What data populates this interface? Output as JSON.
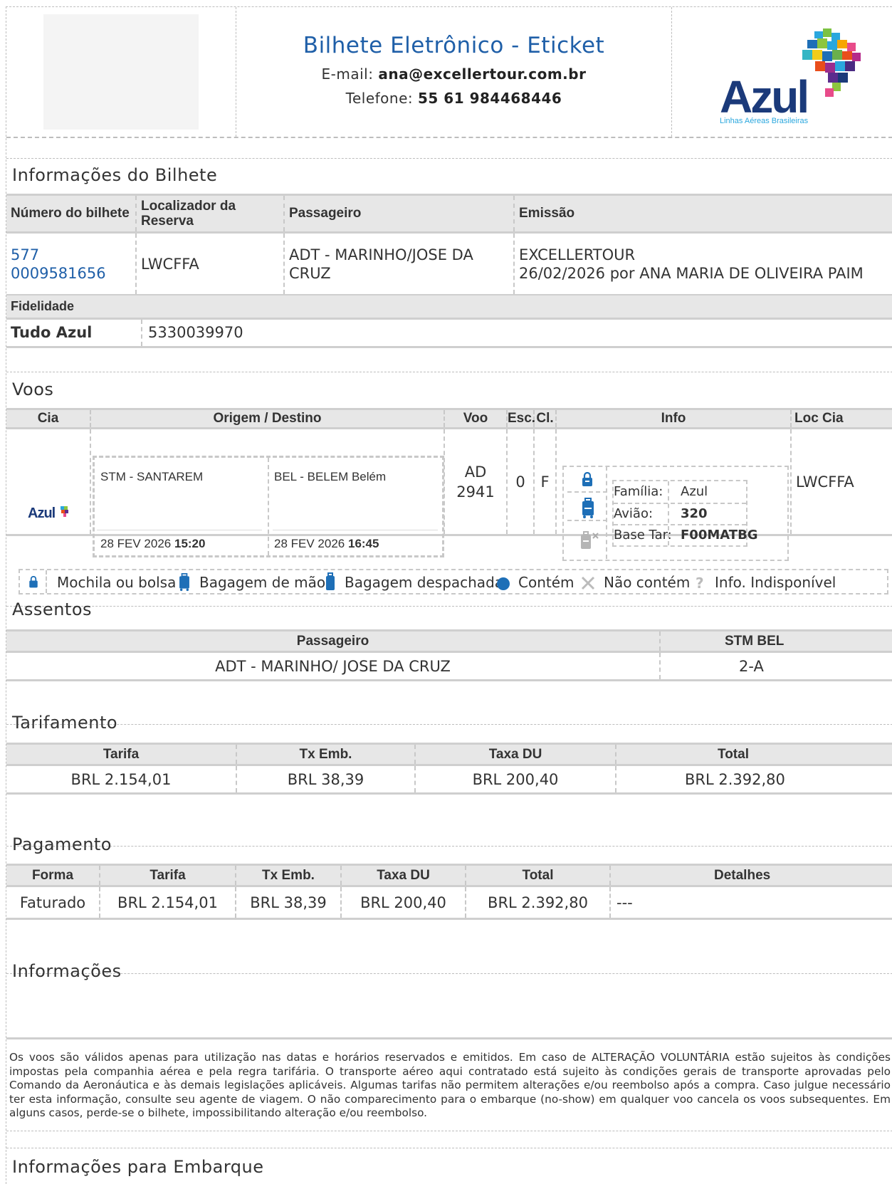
{
  "header": {
    "title": "Bilhete Eletrônico - Eticket",
    "email_label": "E-mail:",
    "email": "ana@excellertour.com.br",
    "phone_label": "Telefone:",
    "phone": "55 61 984468446",
    "airline_logo_text": "Azul",
    "airline_logo_sub": "Linhas Aéreas Brasileiras"
  },
  "ticket_info": {
    "title": "Informações do Bilhete",
    "headers": [
      "Número do bilhete",
      "Localizador da Reserva",
      "Passageiro",
      "Emissão"
    ],
    "ticket_number_1": "577",
    "ticket_number_2": "0009581656",
    "locator": "LWCFFA",
    "passenger": "ADT - MARINHO/JOSE DA CRUZ",
    "issue_1": "EXCELLERTOUR",
    "issue_2": "26/02/2026 por ANA MARIA DE OLIVEIRA PAIM",
    "loyalty_header": "Fidelidade",
    "loyalty_program": "Tudo Azul",
    "loyalty_number": "5330039970"
  },
  "flights": {
    "title": "Voos",
    "headers": [
      "Cia",
      "Origem / Destino",
      "Voo",
      "Esc.",
      "Cl.",
      "Info",
      "Loc Cia"
    ],
    "airline_logo": "Azul",
    "origin": "STM - SANTAREM",
    "origin_date": "28 FEV 2026",
    "origin_time": "15:20",
    "destination": "BEL - BELEM Belém",
    "destination_date": "28 FEV 2026",
    "destination_time": "16:45",
    "flight_1": "AD",
    "flight_2": "2941",
    "stops": "0",
    "class": "F",
    "family_label": "Família:",
    "family": "Azul",
    "aircraft_label": "Avião:",
    "aircraft": "320",
    "fare_basis_label": "Base Tar:",
    "fare_basis": "F00MATBG",
    "loc_cia": "LWCFFA"
  },
  "legend": {
    "backpack": "Mochila ou bolsa",
    "carry_on": "Bagagem de mão",
    "checked": "Bagagem despachada",
    "contains": "Contém",
    "not_contains": "Não contém",
    "unavailable": "Info. Indisponível"
  },
  "seats": {
    "title": "Assentos",
    "headers": [
      "Passageiro",
      "STM BEL"
    ],
    "passenger": "ADT - MARINHO/ JOSE DA CRUZ",
    "seat": "2-A"
  },
  "fares": {
    "title": "Tarifamento",
    "headers": [
      "Tarifa",
      "Tx Emb.",
      "Taxa DU",
      "Total"
    ],
    "values": [
      "BRL 2.154,01",
      "BRL 38,39",
      "BRL 200,40",
      "BRL 2.392,80"
    ]
  },
  "payment": {
    "title": "Pagamento",
    "headers": [
      "Forma",
      "Tarifa",
      "Tx Emb.",
      "Taxa DU",
      "Total",
      "Detalhes"
    ],
    "values": [
      "Faturado",
      "BRL 2.154,01",
      "BRL 38,39",
      "BRL 200,40",
      "BRL 2.392,80",
      "---"
    ]
  },
  "info": {
    "title": "Informações",
    "text": "Os voos são válidos apenas para utilização nas datas e horários reservados e emitidos. Em caso de ALTERAÇÃO VOLUNTÁRIA estão sujeitos às condições impostas pela companhia aérea e pela regra tarifária. O transporte aéreo aqui contratado está sujeito às condições gerais de transporte aprovadas pelo Comando da Aeronáutica e às demais legislações aplicáveis. Algumas tarifas não permitem alterações e/ou reembolso após a compra. Caso julgue necessário ter esta informação, consulte seu agente de viagem. O não comparecimento para o embarque (no-show) em qualquer voo cancela os voos subsequentes. Em alguns casos, perde-se o bilhete, impossibilitando alteração e/ou reembolso."
  },
  "boarding": {
    "title": "Informações para Embarque"
  },
  "colors": {
    "title_blue": "#1f5fa8",
    "header_gray": "#e7e7e7",
    "azul_navy": "#1b3a7a"
  }
}
